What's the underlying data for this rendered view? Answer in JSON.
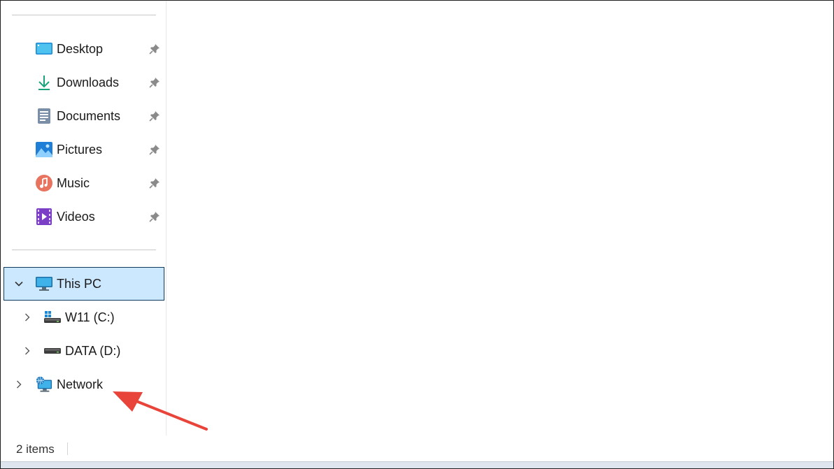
{
  "navigation": {
    "quick_access": [
      {
        "id": "desktop",
        "label": "Desktop",
        "icon": "desktop-icon",
        "pinned": true
      },
      {
        "id": "downloads",
        "label": "Downloads",
        "icon": "download-icon",
        "pinned": true
      },
      {
        "id": "documents",
        "label": "Documents",
        "icon": "document-icon",
        "pinned": true
      },
      {
        "id": "pictures",
        "label": "Pictures",
        "icon": "pictures-icon",
        "pinned": true
      },
      {
        "id": "music",
        "label": "Music",
        "icon": "music-icon",
        "pinned": true
      },
      {
        "id": "videos",
        "label": "Videos",
        "icon": "videos-icon",
        "pinned": true
      }
    ],
    "this_pc": {
      "label": "This PC",
      "expanded": true,
      "selected": true,
      "icon": "monitor-icon"
    },
    "drives": [
      {
        "id": "c",
        "label": "W11 (C:)",
        "icon": "windows-drive-icon"
      },
      {
        "id": "d",
        "label": "DATA (D:)",
        "icon": "drive-icon"
      }
    ],
    "network": {
      "label": "Network",
      "icon": "network-icon"
    }
  },
  "status_bar": {
    "item_count": "2 items"
  },
  "colors": {
    "selection_bg": "#cce8ff",
    "selection_border": "#0d3a5e",
    "annotation_arrow": "#e8443a"
  }
}
